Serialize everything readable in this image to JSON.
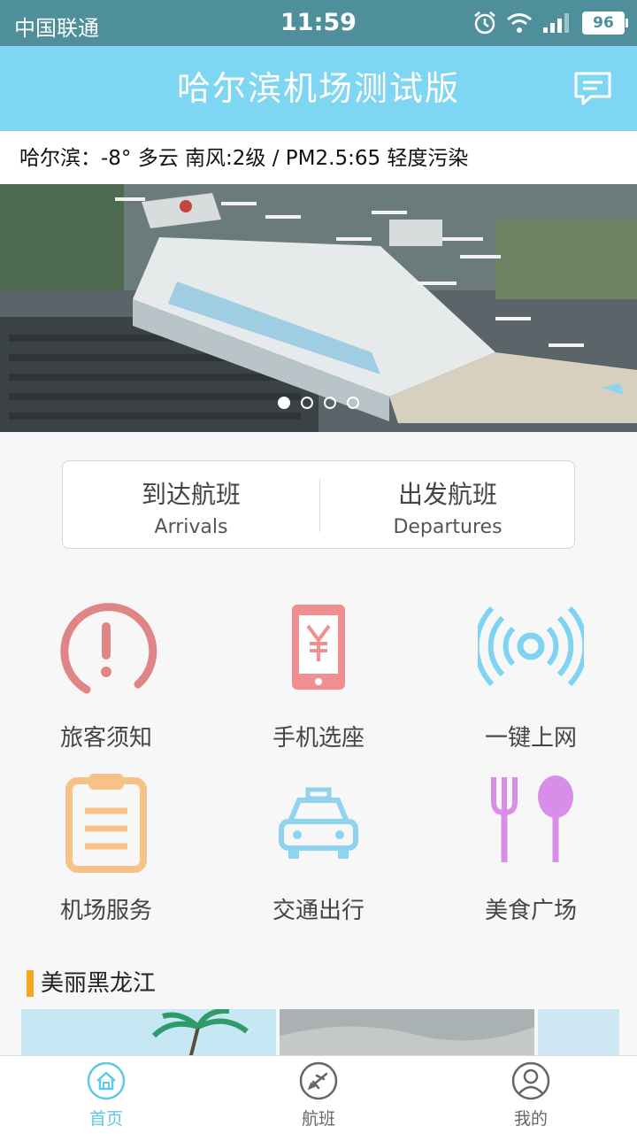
{
  "status_bar": {
    "carrier": "中国联通",
    "time": "11:59",
    "battery": "96"
  },
  "header": {
    "title": "哈尔滨机场测试版",
    "message_icon": "message-icon"
  },
  "weather": {
    "text": "哈尔滨：-8° 多云 南风:2级 / PM2.5:65  轻度污染"
  },
  "banner": {
    "slide_count": 4,
    "active_index": 0
  },
  "flights": {
    "arrivals_cn": "到达航班",
    "arrivals_en": "Arrivals",
    "departures_cn": "出发航班",
    "departures_en": "Departures"
  },
  "services": [
    {
      "label": "旅客须知",
      "icon": "notice-icon",
      "color": "#e08585"
    },
    {
      "label": "手机选座",
      "icon": "phone-seat-icon",
      "color": "#f08f90"
    },
    {
      "label": "一键上网",
      "icon": "wifi-icon",
      "color": "#7fd3f2"
    },
    {
      "label": "机场服务",
      "icon": "clipboard-icon",
      "color": "#f6c288"
    },
    {
      "label": "交通出行",
      "icon": "taxi-icon",
      "color": "#8fd3ee"
    },
    {
      "label": "美食广场",
      "icon": "fork-spoon-icon",
      "color": "#d88ee6"
    }
  ],
  "section": {
    "title": "美丽黑龙江"
  },
  "tabs": [
    {
      "label": "首页",
      "icon": "home-icon",
      "active": true
    },
    {
      "label": "航班",
      "icon": "plane-icon",
      "active": false
    },
    {
      "label": "我的",
      "icon": "user-icon",
      "active": false
    }
  ],
  "colors": {
    "title_bar": "#7fd6f2",
    "status_bar": "#4f8f9c",
    "accent": "#5ec8e8",
    "section_marker": "#f5a623"
  }
}
